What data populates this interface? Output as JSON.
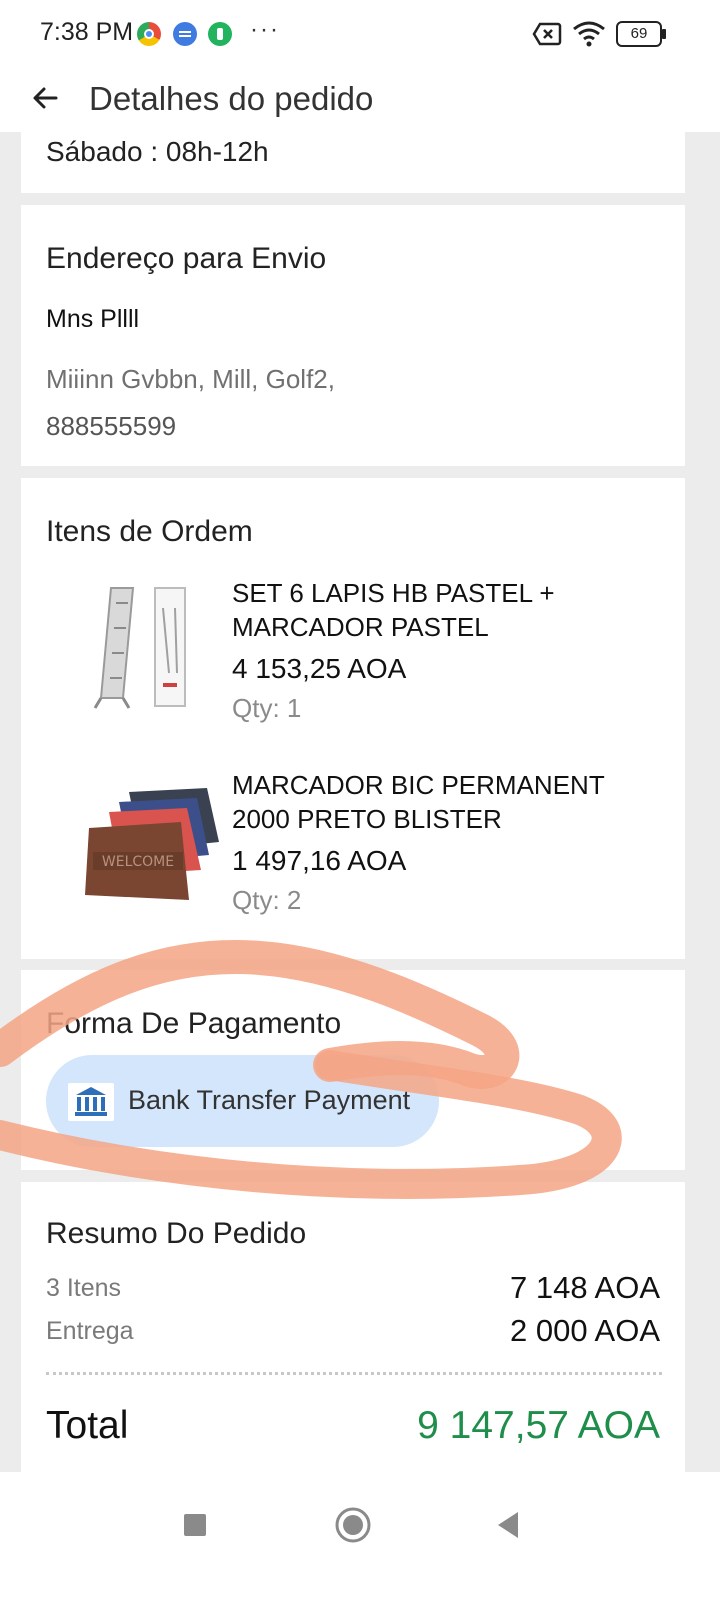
{
  "status_bar": {
    "time": "7:38 PM",
    "dots": "···",
    "battery": "69",
    "icons": [
      "chrome-like-icon",
      "message-icon",
      "shield-app-icon",
      "sim-off-icon",
      "wifi-icon",
      "battery-icon"
    ]
  },
  "header": {
    "title": "Detalhes do pedido",
    "back_icon": "arrow-left-icon"
  },
  "hours": {
    "text": "Sábado : 08h-12h"
  },
  "shipping": {
    "heading": "Endereço para Envio",
    "name": "Mns Pllll",
    "address": "Miiinn Gvbbn, Mill, Golf2,",
    "phone": "888555599"
  },
  "items": {
    "heading": "Itens de Ordem",
    "list": [
      {
        "name": "SET 6 LAPIS HB PASTEL + MARCADOR PASTEL",
        "price": "4 153,25 AOA",
        "qty": "Qty: 1",
        "thumb": "laptop-stand-product-image"
      },
      {
        "name": "MARCADOR BIC PERMANENT 2000 PRETO BLISTER",
        "price": "1 497,16 AOA",
        "qty": "Qty: 2",
        "thumb": "doormat-product-image",
        "thumb_text": "WELCOME"
      }
    ]
  },
  "payment": {
    "heading": "Forma De Pagamento",
    "method": "Bank Transfer Payment",
    "icon": "bank-icon",
    "chip_color": "#d3e6fb"
  },
  "summary": {
    "heading": "Resumo Do Pedido",
    "items_label": "3 Itens",
    "items_value": "7 148 AOA",
    "delivery_label": "Entrega",
    "delivery_value": "2 000 AOA",
    "total_label": "Total",
    "total_value": "9 147,57 AOA",
    "total_color": "#1e8e4a"
  },
  "nav": {
    "buttons": [
      "recents-square-icon",
      "home-circle-icon",
      "back-triangle-icon"
    ]
  },
  "annotation": {
    "color": "#f4a585"
  }
}
